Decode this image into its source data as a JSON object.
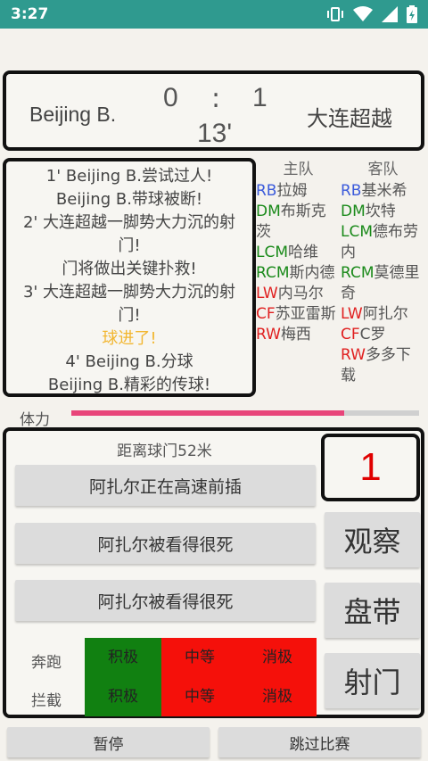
{
  "status_bar": {
    "time": "3:27",
    "icons": [
      "vibrate-icon",
      "wifi-icon",
      "signal-icon",
      "battery-icon"
    ]
  },
  "scoreboard": {
    "home_team": "Beijing B.",
    "away_team": "大连超越",
    "home_score": "0",
    "separator": ":",
    "away_score": "1",
    "minute": "13'"
  },
  "commentary": [
    {
      "text": "1'  Beijing B.尝试过人!",
      "highlight": false
    },
    {
      "text": "Beijing B.带球被断!",
      "highlight": false
    },
    {
      "text": "2'  大连超越一脚势大力沉的射",
      "highlight": false
    },
    {
      "text": "门!",
      "highlight": false
    },
    {
      "text": "门将做出关键扑救!",
      "highlight": false
    },
    {
      "text": "3'  大连超越一脚势大力沉的射",
      "highlight": false
    },
    {
      "text": "门!",
      "highlight": false
    },
    {
      "text": "球进了!",
      "highlight": true
    },
    {
      "text": "4'  Beijing B.分球",
      "highlight": false
    },
    {
      "text": "Beijing B.精彩的传球!",
      "highlight": false
    }
  ],
  "lineup": {
    "home_header": "主队",
    "away_header": "客队",
    "home": [
      {
        "pos": "RB",
        "name": "拉姆",
        "cls": "pos-rb"
      },
      {
        "pos": "DM",
        "name": "布斯克茨",
        "cls": "pos-dm"
      },
      {
        "pos": "LCM",
        "name": "哈维",
        "cls": "pos-lcm"
      },
      {
        "pos": "RCM",
        "name": "斯内德",
        "cls": "pos-rcm"
      },
      {
        "pos": "LW",
        "name": "内马尔",
        "cls": "pos-lw"
      },
      {
        "pos": "CF",
        "name": "苏亚雷斯",
        "cls": "pos-cf"
      },
      {
        "pos": "RW",
        "name": "梅西",
        "cls": "pos-rw"
      }
    ],
    "away": [
      {
        "pos": "RB",
        "name": "基米希",
        "cls": "pos-rb"
      },
      {
        "pos": "DM",
        "name": "坎特",
        "cls": "pos-dm"
      },
      {
        "pos": "LCM",
        "name": "德布劳内",
        "cls": "pos-lcm"
      },
      {
        "pos": "RCM",
        "name": "莫德里奇",
        "cls": "pos-rcm"
      },
      {
        "pos": "LW",
        "name": "阿扎尔",
        "cls": "pos-lw"
      },
      {
        "pos": "CF",
        "name": "C罗",
        "cls": "pos-cf"
      },
      {
        "pos": "RW",
        "name": "多多下载",
        "cls": "pos-rw"
      }
    ]
  },
  "stamina": {
    "label": "体力",
    "level_percent": 78.5
  },
  "action_panel": {
    "distance": "距离球门52米",
    "options": [
      "阿扎尔正在高速前插",
      "阿扎尔被看得很死",
      "阿扎尔被看得很死"
    ],
    "counter": "1",
    "actions": [
      "观察",
      "盘带",
      "射门"
    ],
    "tactics": {
      "run_label": "奔跑",
      "intercept_label": "拦截",
      "levels": [
        "积极",
        "中等",
        "消极"
      ],
      "colors": {
        "positive": "#118011",
        "neutral": "#f5100a",
        "negative": "#f5100a"
      }
    }
  },
  "bottom": {
    "pause": "暂停",
    "skip": "跳过比赛"
  }
}
